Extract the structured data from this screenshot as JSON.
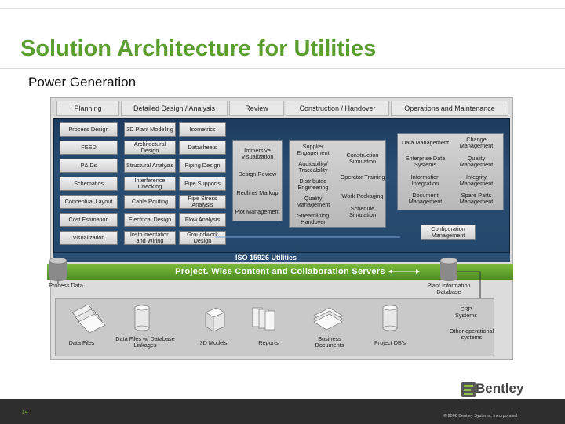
{
  "title": "Solution Architecture for Utilities",
  "subtitle": "Power Generation",
  "phases": [
    "Planning",
    "Detailed Design / Analysis",
    "Review",
    "Construction / Handover",
    "Operations and Maintenance"
  ],
  "planning": [
    "Process Design",
    "FEED",
    "P&IDs",
    "Schematics",
    "Conceptual Layout",
    "Cost Estimation",
    "Visualization"
  ],
  "design_a": [
    "3D Plant Modeling",
    "Architectural Design",
    "Structural Analysis",
    "Interference Checking",
    "Cable Routing",
    "Electrical Design",
    "Instrumentation and Wiring"
  ],
  "design_b": [
    "Isometrics",
    "Datasheets",
    "Piping Design",
    "Pipe Supports",
    "Pipe Stress Analysis",
    "Flow Analysis",
    "Groundwork Design"
  ],
  "review": [
    "Immersive Visualization",
    "Design Review",
    "Redline/ Markup",
    "Plot Management"
  ],
  "construction_a": [
    "Supplier Engagement",
    "Auditability/ Traceability",
    "Distributed Engineering",
    "Quality Management",
    "Streamlining Handover"
  ],
  "construction_b": [
    "Construction Simulation",
    "Operator Training",
    "Work Packaging",
    "Schedule Simulation"
  ],
  "operations_a": [
    "Data Management",
    "Enterprise Data Systems",
    "Information Integration",
    "Document Management"
  ],
  "operations_b": [
    "Change Management",
    "Quality Management",
    "Integrity Management",
    "Spare Parts Management"
  ],
  "configuration": "Configuration Management",
  "iso": "ISO 15926 Utilities",
  "projectwise": "Project. Wise Content and Collaboration Servers",
  "process_data": "Process Data",
  "plant_info": "Plant Information Database",
  "erp": "ERP Systems",
  "other_systems": "Other operational systems",
  "repositories": [
    "Data Files",
    "Data Files w/ Database Linkages",
    "3D Models",
    "Reports",
    "Business Documents",
    "Project DB's"
  ],
  "logo": "Bentley",
  "page_number": "24",
  "copyright": "© 2006 Bentley Systems, Incorporated",
  "colors": {
    "title_green": "#5a9e2e",
    "band_navy": "#24486c",
    "projectwise_green": "#5a9e2e"
  }
}
